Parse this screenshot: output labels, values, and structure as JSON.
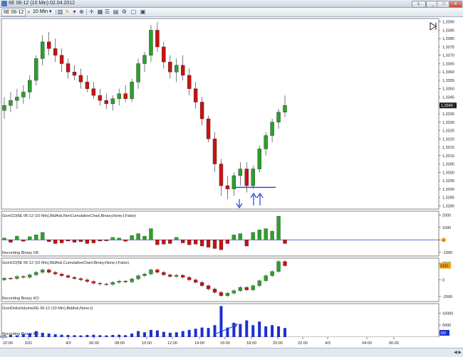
{
  "window": {
    "title": "6E 06-12 (10 Min)  02.04.2012",
    "buttons": [
      "L",
      "_",
      "□",
      "X"
    ]
  },
  "toolbar": {
    "instrument": "6E 06-12",
    "interval": "10 Min",
    "icons": [
      "magnifier-icon",
      "bar-style-icon",
      "pencil-icon",
      "draw-tools-icon",
      "zoom-icon",
      "crosshair-icon",
      "tile-icon",
      "properties-icon",
      "data-box-icon",
      "strategy-icon",
      "window-icon"
    ]
  },
  "price_panel": {
    "ticks": [
      "1,3390",
      "1,3380",
      "1,3370",
      "1,3360",
      "1,3350",
      "1,3340",
      "1,3330",
      "1,3320",
      "1,3310",
      "1,3300",
      "1,3290",
      "1,3280"
    ],
    "extra_ticks": [
      "1,3385",
      "1,3375",
      "1,3365",
      "1,3355",
      "1,3345",
      "1,3335",
      "1,3325",
      "1,3315",
      "1,3305",
      "1,3295",
      "1,3285"
    ],
    "last_price": "1,3340"
  },
  "panels": [
    {
      "label": "GomCD(6E 06-12 (10 Min),BidAsk,NonCumulativeChart,Binary,None,f,False)",
      "status": "Recording Binary OK",
      "ticks": [
        "2000",
        "1000",
        "0",
        "-1000"
      ],
      "marker": "0"
    },
    {
      "label": "GomCD(6E 06-12 (10 Min),BidAsk,CumulativeChart,Binary,None,f,False)",
      "status": "Recording Binary KO",
      "ticks": [
        "2000",
        "0",
        "-2000"
      ],
      "marker": "1333"
    },
    {
      "label": "GomDeltaVolume(6E 06-12 (10 Min),BidAsk,None,t)",
      "status": "Recording Binary KO",
      "ticks": [
        "10000",
        "5000"
      ],
      "marker": "320"
    }
  ],
  "time_axis": [
    "22:00",
    "3/31",
    "4/2",
    "06:00",
    "08:00",
    "10:00",
    "12:00",
    "14:00",
    "16:00",
    "18:00",
    "20:00",
    "22:00",
    "4/3",
    "04:00",
    "06:00"
  ],
  "colors": {
    "up": "#2ca02c",
    "down": "#cc1111",
    "line": "#1f3fd8",
    "volume": "#1c2fd0"
  },
  "chart_data": {
    "type": "candlestick",
    "y_range": [
      1.3278,
      1.3392
    ],
    "candles": [
      [
        1.3337,
        1.3345,
        1.3332,
        1.334
      ],
      [
        1.334,
        1.3348,
        1.3336,
        1.3343
      ],
      [
        1.3343,
        1.335,
        1.3338,
        1.3345
      ],
      [
        1.3345,
        1.3352,
        1.3341,
        1.3348
      ],
      [
        1.3348,
        1.3358,
        1.3344,
        1.3355
      ],
      [
        1.3355,
        1.337,
        1.3352,
        1.3368
      ],
      [
        1.3368,
        1.3382,
        1.3364,
        1.3378
      ],
      [
        1.3378,
        1.3384,
        1.337,
        1.3374
      ],
      [
        1.3374,
        1.338,
        1.3366,
        1.337
      ],
      [
        1.337,
        1.3374,
        1.336,
        1.3365
      ],
      [
        1.3365,
        1.3368,
        1.3356,
        1.336
      ],
      [
        1.336,
        1.3364,
        1.3355,
        1.3358
      ],
      [
        1.3358,
        1.3362,
        1.335,
        1.3354
      ],
      [
        1.3354,
        1.3358,
        1.3348,
        1.335
      ],
      [
        1.335,
        1.3354,
        1.3344,
        1.3346
      ],
      [
        1.3346,
        1.335,
        1.334,
        1.3343
      ],
      [
        1.3343,
        1.3347,
        1.3338,
        1.3341
      ],
      [
        1.3341,
        1.3346,
        1.3337,
        1.3344
      ],
      [
        1.3344,
        1.335,
        1.334,
        1.3347
      ],
      [
        1.3347,
        1.3352,
        1.3342,
        1.3344
      ],
      [
        1.3344,
        1.3356,
        1.3342,
        1.3354
      ],
      [
        1.3354,
        1.3368,
        1.335,
        1.3365
      ],
      [
        1.3365,
        1.3372,
        1.336,
        1.337
      ],
      [
        1.337,
        1.3388,
        1.3366,
        1.3385
      ],
      [
        1.3385,
        1.339,
        1.3372,
        1.3375
      ],
      [
        1.3375,
        1.3378,
        1.3362,
        1.3366
      ],
      [
        1.3366,
        1.337,
        1.3356,
        1.336
      ],
      [
        1.336,
        1.3368,
        1.3354,
        1.3364
      ],
      [
        1.3364,
        1.337,
        1.3355,
        1.3358
      ],
      [
        1.3358,
        1.3362,
        1.3346,
        1.335
      ],
      [
        1.335,
        1.3354,
        1.3338,
        1.3342
      ],
      [
        1.3342,
        1.3345,
        1.3328,
        1.3332
      ],
      [
        1.3332,
        1.3334,
        1.3318,
        1.332
      ],
      [
        1.332,
        1.3324,
        1.33,
        1.3305
      ],
      [
        1.3305,
        1.3308,
        1.3286,
        1.3292
      ],
      [
        1.3292,
        1.3298,
        1.3284,
        1.329
      ],
      [
        1.329,
        1.33,
        1.3286,
        1.3298
      ],
      [
        1.3298,
        1.3306,
        1.3292,
        1.3302
      ],
      [
        1.3302,
        1.3306,
        1.3288,
        1.3292
      ],
      [
        1.3292,
        1.3304,
        1.329,
        1.3302
      ],
      [
        1.3302,
        1.3316,
        1.33,
        1.3314
      ],
      [
        1.3314,
        1.3324,
        1.331,
        1.3322
      ],
      [
        1.3322,
        1.3332,
        1.3318,
        1.333
      ],
      [
        1.333,
        1.3338,
        1.3326,
        1.3336
      ],
      [
        1.3336,
        1.3346,
        1.3333,
        1.334
      ]
    ],
    "cd_noncumulative": [
      150,
      -200,
      300,
      -120,
      250,
      400,
      600,
      -150,
      -300,
      -250,
      -100,
      -200,
      -150,
      -300,
      -250,
      -100,
      -80,
      200,
      150,
      -120,
      350,
      500,
      300,
      900,
      -400,
      -350,
      -300,
      200,
      -250,
      -400,
      -350,
      -500,
      -600,
      -700,
      -800,
      -300,
      400,
      500,
      -500,
      600,
      800,
      900,
      700,
      1900,
      -300
    ],
    "cd_cumulative": [
      200,
      150,
      400,
      300,
      600,
      900,
      1200,
      900,
      700,
      500,
      300,
      150,
      0,
      -200,
      -400,
      -500,
      -550,
      -300,
      -150,
      -250,
      100,
      500,
      700,
      1200,
      900,
      600,
      400,
      550,
      300,
      0,
      -300,
      -700,
      -1100,
      -1500,
      -1900,
      -1600,
      -1300,
      -900,
      -1200,
      -700,
      -100,
      500,
      1000,
      2200,
      1700
    ],
    "volume": [
      800,
      900,
      700,
      1200,
      1500,
      2500,
      1800,
      1500,
      1200,
      1000,
      900,
      800,
      700,
      900,
      1000,
      800,
      700,
      900,
      1000,
      800,
      1500,
      2500,
      2000,
      3000,
      2800,
      2200,
      1800,
      2000,
      2500,
      3000,
      3500,
      4000,
      3800,
      5000,
      13000,
      4000,
      6000,
      5500,
      7000,
      5000,
      6500,
      4500,
      5000,
      4500,
      3800
    ]
  }
}
